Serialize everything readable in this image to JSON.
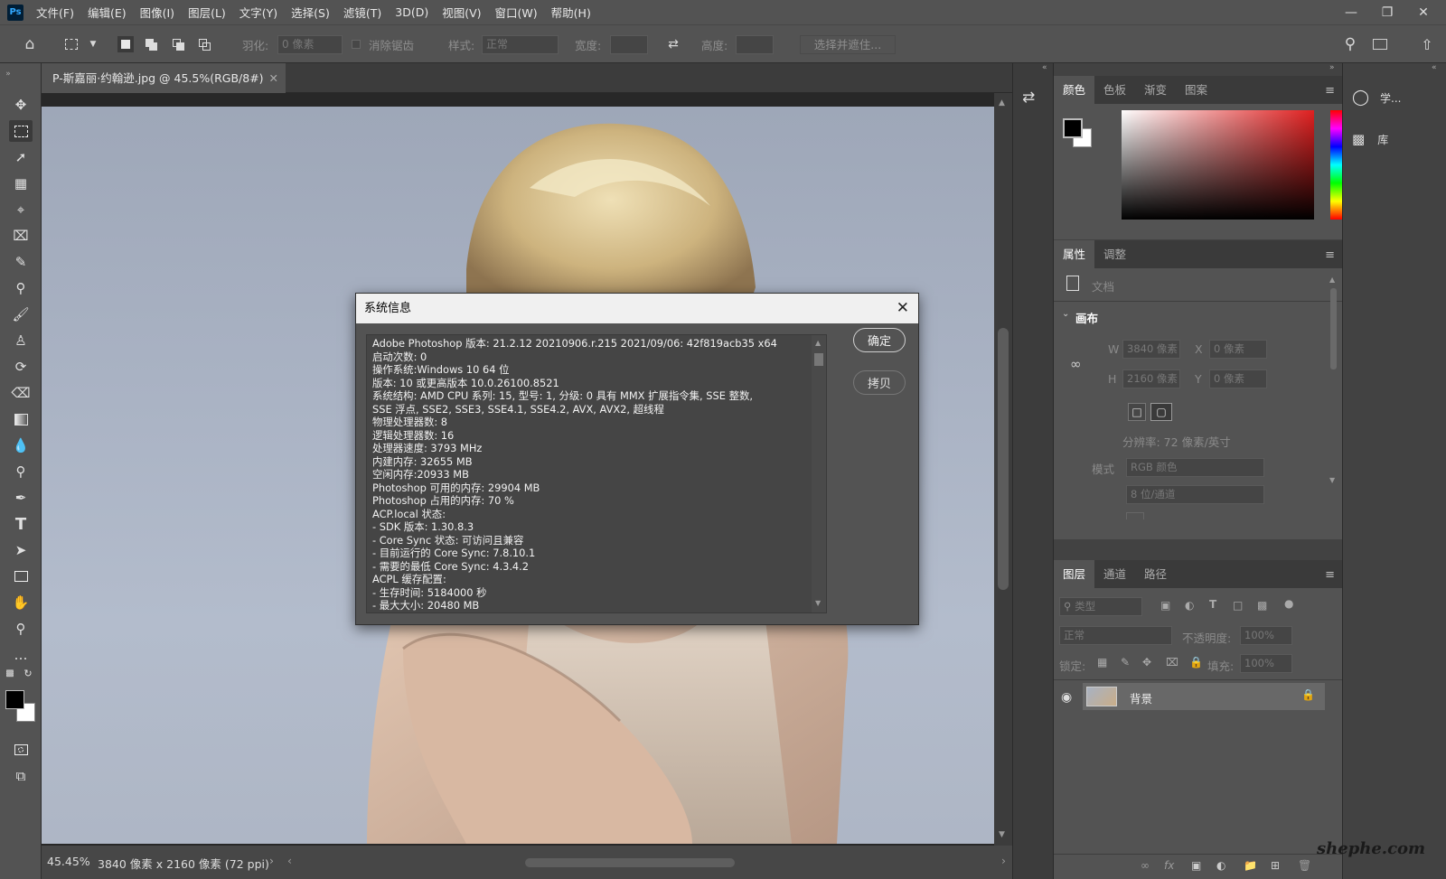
{
  "app": {
    "logo": "Ps"
  },
  "menu": [
    "文件(F)",
    "编辑(E)",
    "图像(I)",
    "图层(L)",
    "文字(Y)",
    "选择(S)",
    "滤镜(T)",
    "3D(D)",
    "视图(V)",
    "窗口(W)",
    "帮助(H)"
  ],
  "options": {
    "feather_label": "羽化:",
    "feather_value": "0 像素",
    "antialias_label": "消除锯齿",
    "style_label": "样式:",
    "style_value": "正常",
    "width_label": "宽度:",
    "height_label": "高度:",
    "select_mask_button": "选择并遮住..."
  },
  "document": {
    "tab_title": "P-斯嘉丽·约翰逊.jpg @ 45.5%(RGB/8#)",
    "zoom": "45.45%",
    "size_info": "3840 像素 x 2160 像素 (72 ppi)"
  },
  "dialog": {
    "title": "系统信息",
    "ok_button": "确定",
    "copy_button": "拷贝",
    "lines": [
      "Adobe Photoshop 版本: 21.2.12 20210906.r.215 2021/09/06: 42f819acb35  x64",
      "启动次数: 0",
      "操作系统:Windows 10 64 位",
      "版本: 10 或更高版本 10.0.26100.8521",
      "系统结构: AMD CPU 系列: 15, 型号: 1, 分级: 0 具有 MMX 扩展指令集, SSE 整数,",
      "SSE 浮点, SSE2, SSE3, SSE4.1, SSE4.2, AVX, AVX2, 超线程",
      "物理处理器数: 8",
      "逻辑处理器数: 16",
      "处理器速度: 3793 MHz",
      "内建内存: 32655 MB",
      "空闲内存:20933 MB",
      "Photoshop 可用的内存: 29904 MB",
      "Photoshop 占用的内存: 70 %",
      "ACP.local 状态:",
      " - SDK 版本: 1.30.8.3",
      " - Core Sync 状态: 可访问且兼容",
      " - 目前运行的 Core Sync: 7.8.10.1",
      " - 需要的最低 Core Sync: 4.3.4.2",
      "ACPL 缓存配置:",
      " - 生存时间: 5184000 秒",
      " - 最大大小: 20480 MB"
    ]
  },
  "color_panel": {
    "tabs": [
      "颜色",
      "色板",
      "渐变",
      "图案"
    ]
  },
  "properties_panel": {
    "tabs": [
      "属性",
      "调整"
    ],
    "doc_label": "文档",
    "canvas_section": "画布",
    "w_label": "W",
    "w_value": "3840 像素",
    "h_label": "H",
    "h_value": "2160 像素",
    "x_label": "X",
    "x_value": "0 像素",
    "y_label": "Y",
    "y_value": "0 像素",
    "resolution": "分辨率: 72 像素/英寸",
    "mode_label": "模式",
    "mode_value": "RGB 颜色",
    "bits_value": "8 位/通道"
  },
  "layers_panel": {
    "tabs": [
      "图层",
      "通道",
      "路径"
    ],
    "filter_placeholder": "类型",
    "blend_mode": "正常",
    "opacity_label": "不透明度:",
    "opacity_value": "100%",
    "lock_label": "锁定:",
    "fill_label": "填充:",
    "fill_value": "100%",
    "layer_name": "背景"
  },
  "far_panel": {
    "learn": "学...",
    "library": "库"
  },
  "watermark": "shephe.com",
  "colors": {
    "foreground": "#000000",
    "background": "#ffffff",
    "panel": "#535353",
    "dark": "#3c3c3c"
  }
}
